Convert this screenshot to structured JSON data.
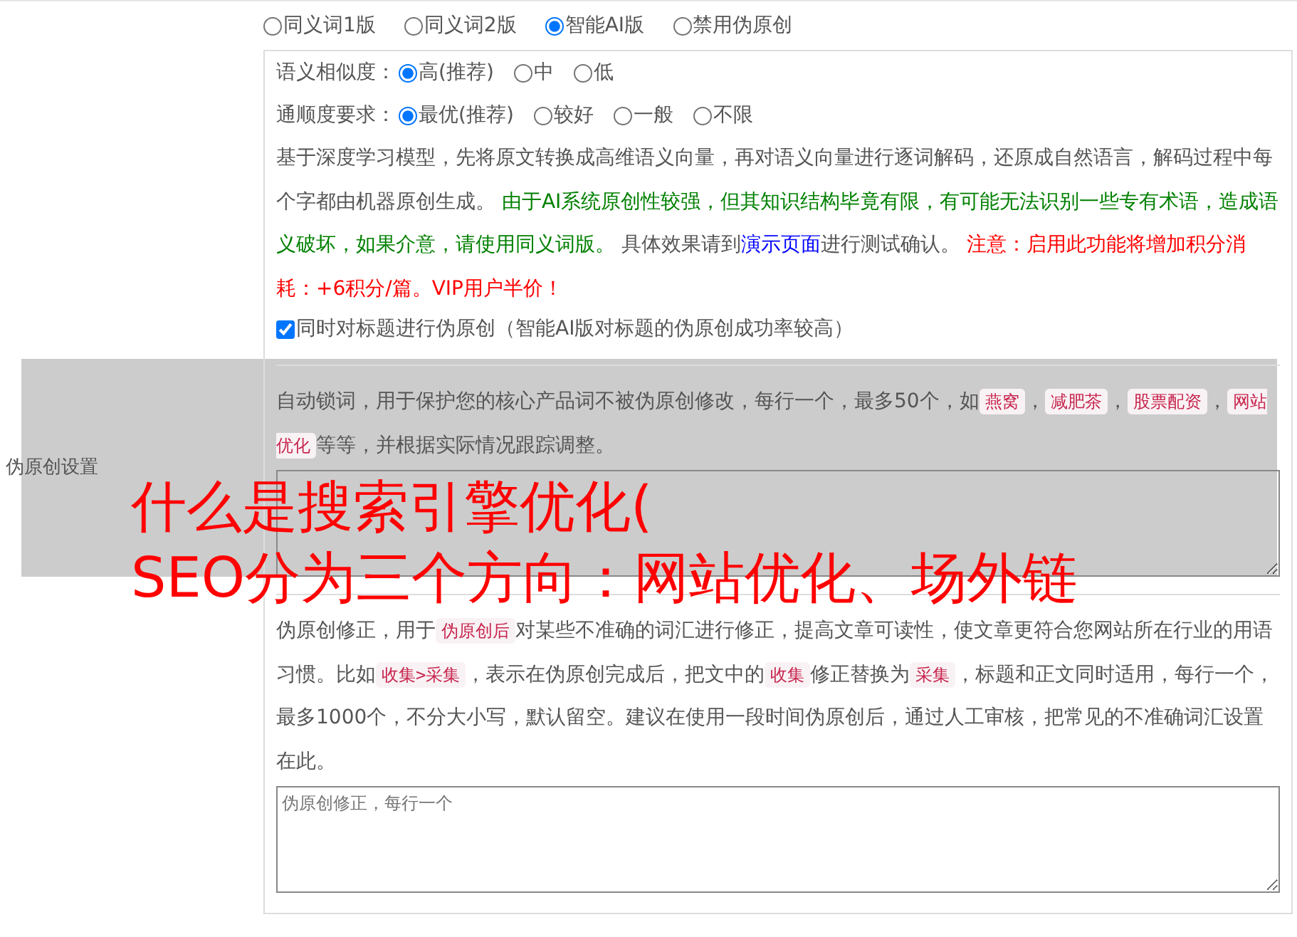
{
  "row_label": "伪原创设置",
  "modes": [
    {
      "label": "同义词1版",
      "selected": false
    },
    {
      "label": "同义词2版",
      "selected": false
    },
    {
      "label": "智能AI版",
      "selected": true
    },
    {
      "label": "禁用伪原创",
      "selected": false
    }
  ],
  "settings": [
    {
      "label": "语义相似度：",
      "options": [
        {
          "label": "高(推荐)",
          "selected": true
        },
        {
          "label": "中",
          "selected": false
        },
        {
          "label": "低",
          "selected": false
        }
      ]
    },
    {
      "label": "通顺度要求：",
      "options": [
        {
          "label": "最优(推荐)",
          "selected": true
        },
        {
          "label": "较好",
          "selected": false
        },
        {
          "label": "一般",
          "selected": false
        },
        {
          "label": "不限",
          "selected": false
        }
      ]
    }
  ],
  "ai_description": {
    "before_link": [
      {
        "color": "#555555",
        "text": "基于深度学习模型，先将原文转换成高维语义向量，再对语义向量进行逐词解码，还原成自然语言，解码过程中每个字都由机器原创生成。 "
      },
      {
        "color": "#008000",
        "text": "由于AI系统原创性较强，但其知识结构毕竟有限，有可能无法识别一些专有术语，造成语义破坏，如果介意，请使用同义词版。"
      },
      {
        "color": "#555555",
        "text": " 具体效果请到"
      }
    ],
    "demo_link": {
      "color": "#0000ff",
      "text": "演示页面"
    },
    "after_link": [
      {
        "color": "#555555",
        "text": "进行测试确认。 "
      },
      {
        "color": "#ff0000",
        "text": "注意：启用此功能将增加积分消耗：+6积分/篇。VIP用户半价！"
      }
    ]
  },
  "title_option": {
    "label": "同时对标题进行伪原创（智能AI版对标题的伪原创成功率较高）",
    "checked": true
  },
  "lock_words": {
    "description": [
      {
        "kind": "text",
        "text": "自动锁词，用于保护您的核心产品词不被伪原创修改，每行一个，最多50个，如"
      },
      {
        "kind": "code",
        "text": "燕窝"
      },
      {
        "kind": "text",
        "text": "，"
      },
      {
        "kind": "code",
        "text": "减肥茶"
      },
      {
        "kind": "text",
        "text": "，"
      },
      {
        "kind": "code",
        "text": "股票配资"
      },
      {
        "kind": "text",
        "text": "，"
      },
      {
        "kind": "code",
        "text": "网站优化"
      },
      {
        "kind": "text",
        "text": "等等，并根据实际情况跟踪调整。"
      }
    ]
  },
  "corrections": {
    "description": [
      {
        "kind": "text",
        "text": "伪原创修正，用于"
      },
      {
        "kind": "code",
        "text": "伪原创后"
      },
      {
        "kind": "text",
        "text": "对某些不准确的词汇进行修正，提高文章可读性，使文章更符合您网站所在行业的用语习惯。比如"
      },
      {
        "kind": "code",
        "text": "收集>采集"
      },
      {
        "kind": "text",
        "text": "，表示在伪原创完成后，把文中的"
      },
      {
        "kind": "code",
        "text": "收集"
      },
      {
        "kind": "text",
        "text": "修正替换为"
      },
      {
        "kind": "code",
        "text": "采集"
      },
      {
        "kind": "text",
        "text": "，标题和正文同时适用，每行一个，最多1000个，不分大小写，默认留空。建议在使用一段时间伪原创后，通过人工审核，把常见的不准确词汇设置在此。"
      }
    ],
    "placeholder": "伪原创修正，每行一个"
  },
  "overlay": {
    "lines": [
      "什么是搜索引擎优化(",
      "SEO分为三个方向：网站优化、场外链"
    ]
  }
}
